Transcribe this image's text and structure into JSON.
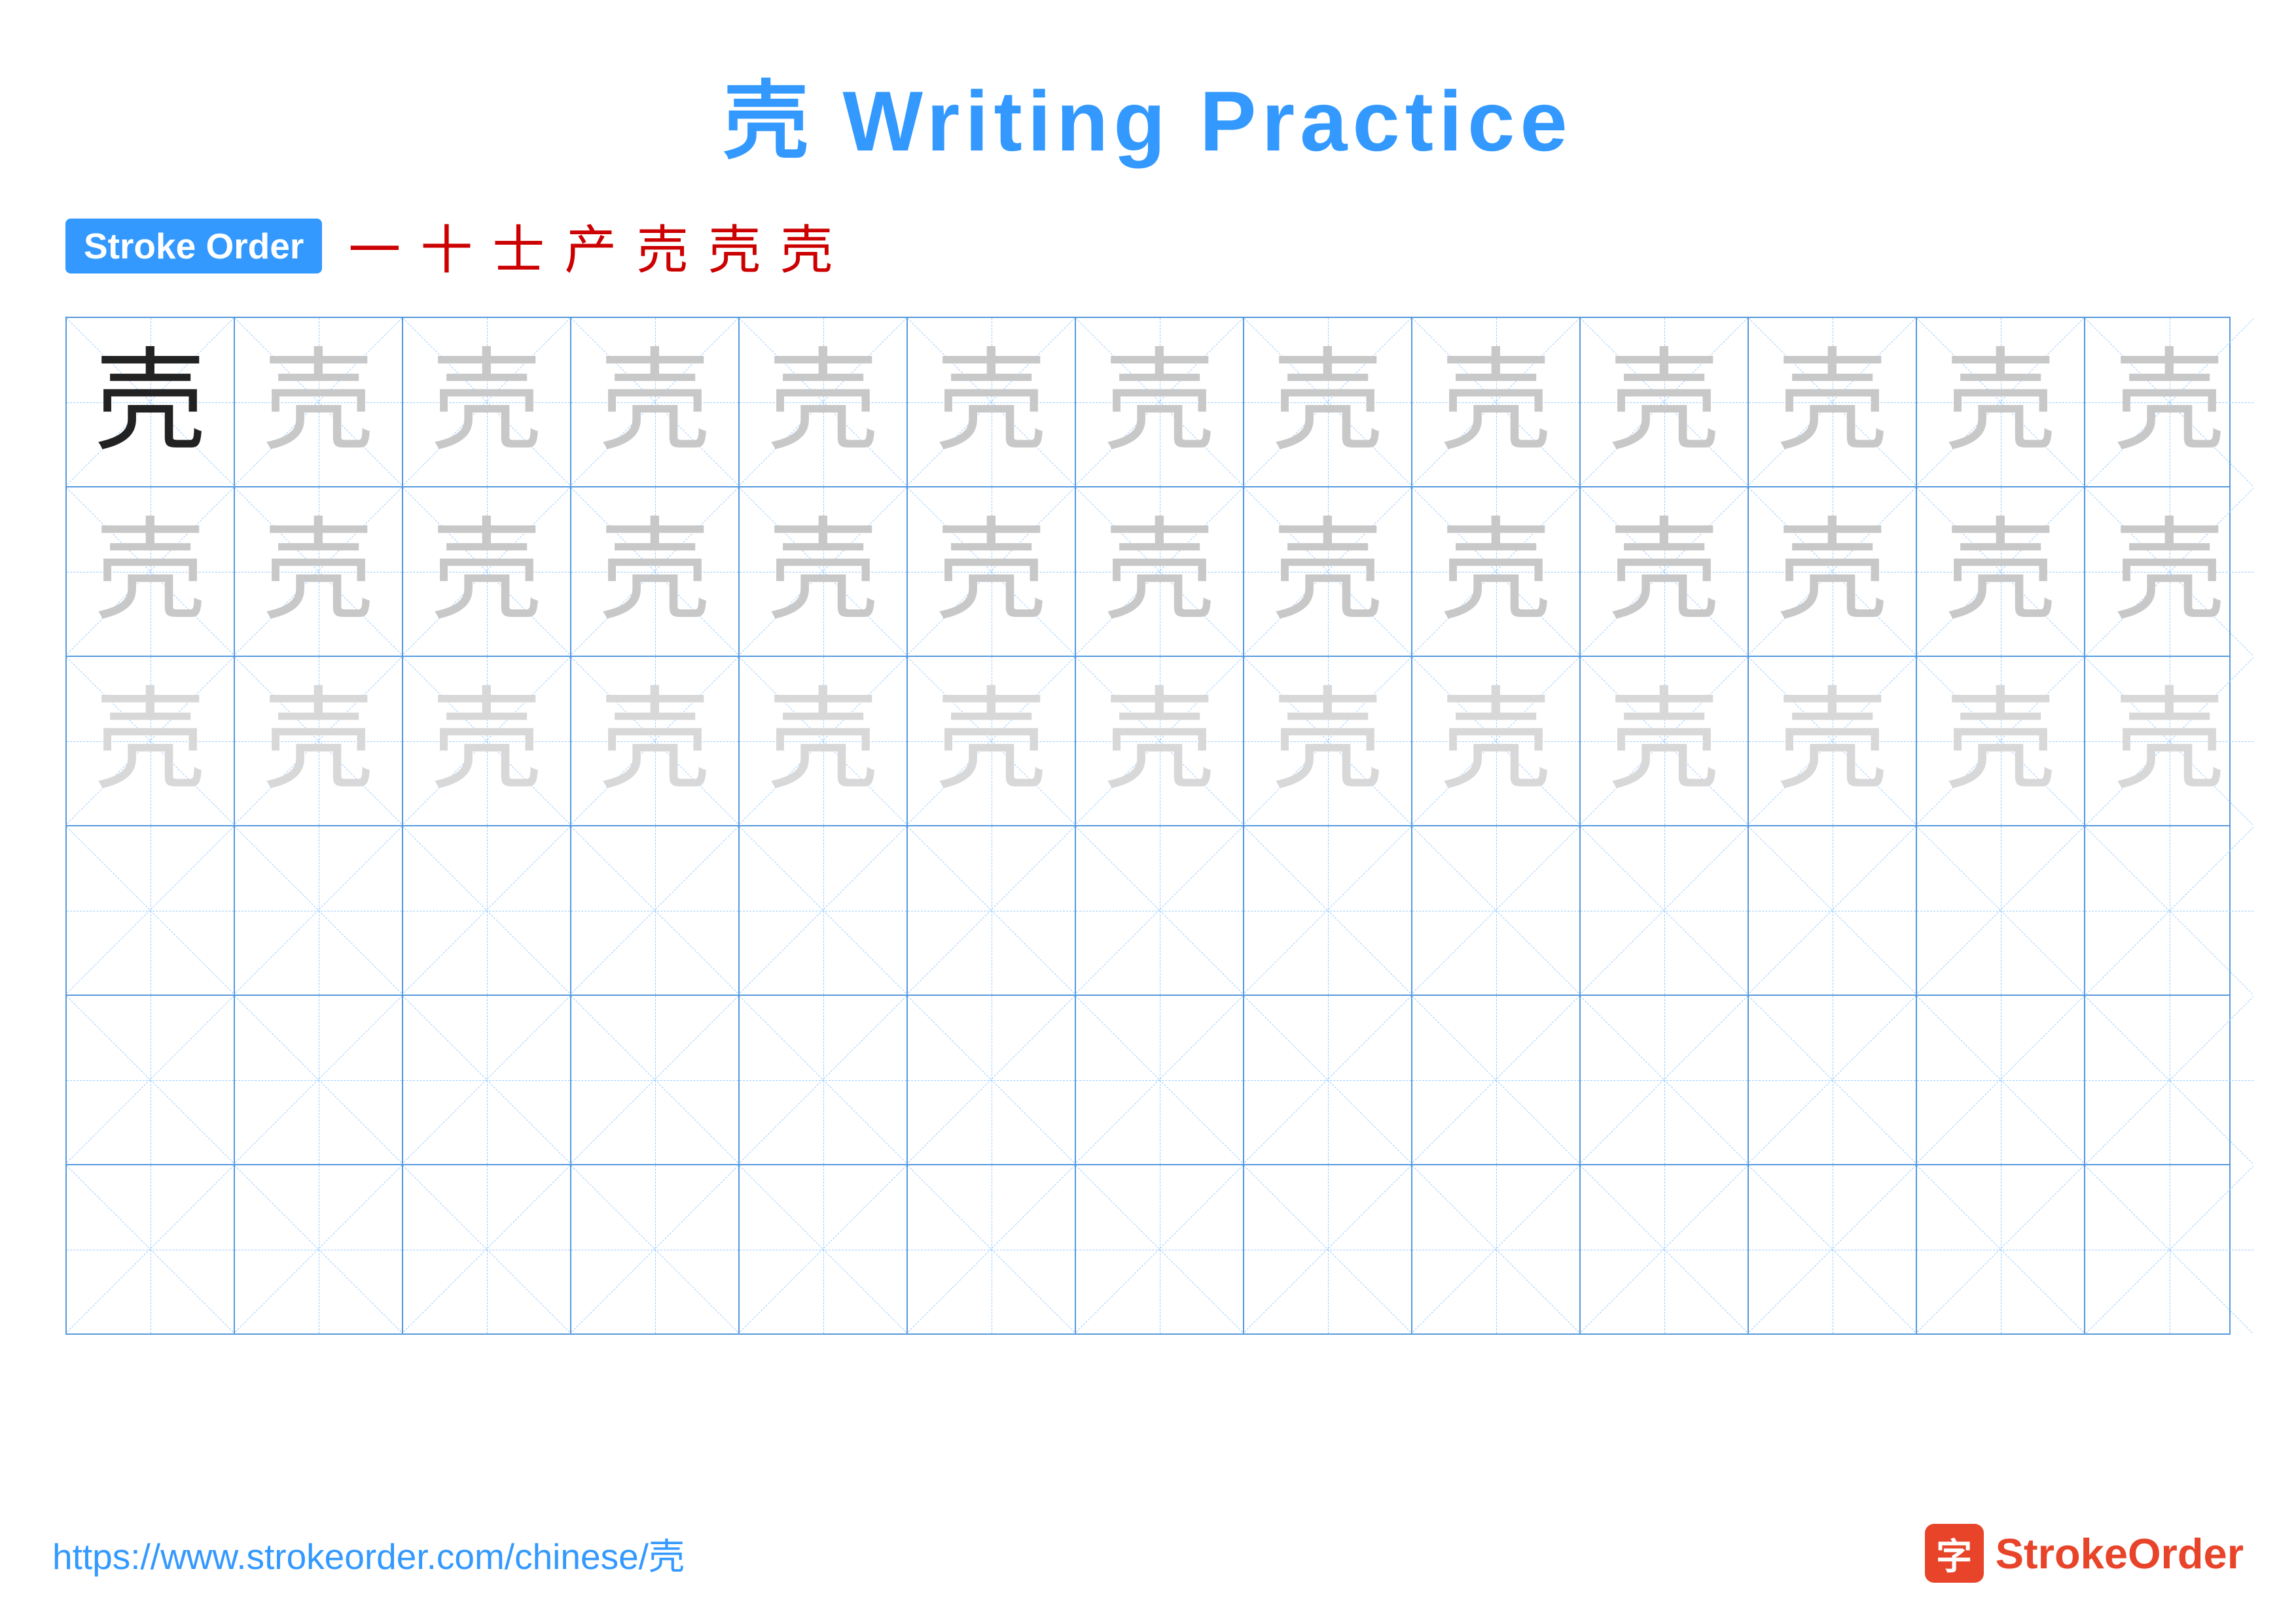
{
  "title": {
    "char": "壳",
    "rest": " Writing Practice"
  },
  "stroke_order": {
    "badge_label": "Stroke Order",
    "strokes": [
      "一",
      "十",
      "士",
      "产",
      "売",
      "壳",
      "壳"
    ]
  },
  "grid": {
    "rows": 6,
    "cols": 13,
    "char": "壳",
    "row1_type": "mixed",
    "row2_type": "ghost_dark",
    "row3_type": "ghost_light",
    "row4_type": "empty",
    "row5_type": "empty",
    "row6_type": "empty"
  },
  "footer": {
    "url": "https://www.strokeorder.com/chinese/壳",
    "logo_char": "字",
    "logo_text_stroke": "Stroke",
    "logo_text_order": "Order"
  }
}
